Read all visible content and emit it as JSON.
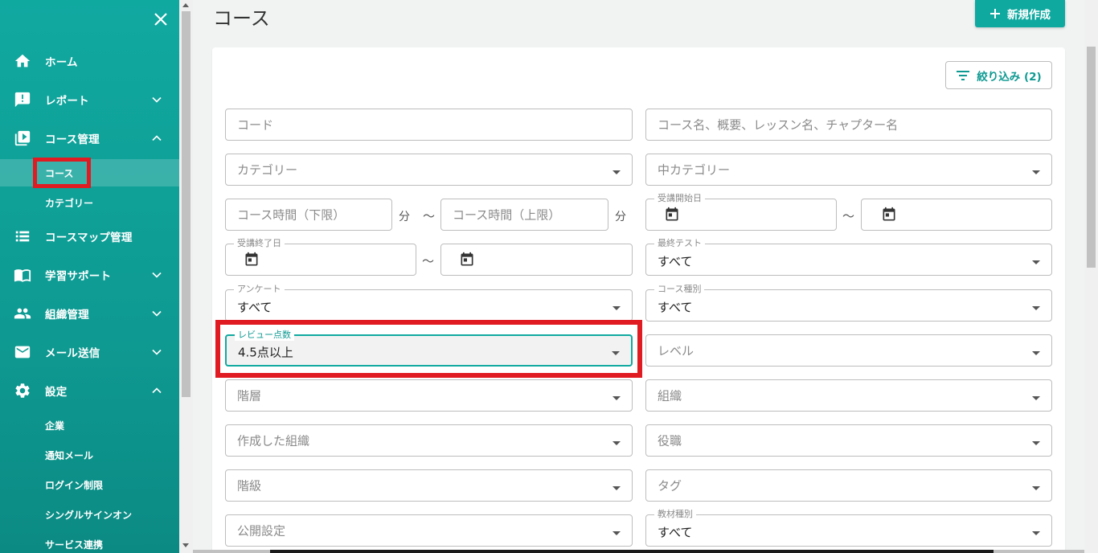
{
  "sidebar": {
    "items": [
      {
        "label": "ホーム",
        "icon": "home-icon"
      },
      {
        "label": "レポート",
        "icon": "report-icon"
      },
      {
        "label": "コース管理",
        "icon": "video-library-icon"
      },
      {
        "label": "コースマップ管理",
        "icon": "list-icon"
      },
      {
        "label": "学習サポート",
        "icon": "book-icon"
      },
      {
        "label": "組織管理",
        "icon": "people-icon"
      },
      {
        "label": "メール送信",
        "icon": "mail-icon"
      },
      {
        "label": "設定",
        "icon": "gear-icon"
      }
    ],
    "course_sub": [
      "コース",
      "カテゴリー"
    ],
    "settings_sub": [
      "企業",
      "通知メール",
      "ログイン制限",
      "シングルサインオン",
      "サービス連携"
    ]
  },
  "header": {
    "title": "コース",
    "new_button": "新規作成"
  },
  "filter_button": "絞り込み (2)",
  "fields": {
    "code": {
      "placeholder": "コード"
    },
    "keyword": {
      "placeholder": "コース名、概要、レッスン名、チャプター名"
    },
    "category": {
      "placeholder": "カテゴリー"
    },
    "mid_category": {
      "placeholder": "中カテゴリー"
    },
    "time_min": {
      "placeholder": "コース時間（下限）",
      "unit": "分"
    },
    "time_max": {
      "placeholder": "コース時間（上限）",
      "unit": "分"
    },
    "range_sep": "〜",
    "start_date": {
      "label": "受講開始日"
    },
    "end_date": {
      "label": "受講終了日"
    },
    "final_test": {
      "label": "最終テスト",
      "value": "すべて"
    },
    "survey": {
      "label": "アンケート",
      "value": "すべて"
    },
    "course_type": {
      "label": "コース種別",
      "value": "すべて"
    },
    "review_score": {
      "label": "レビュー点数",
      "value": "4.5点以上"
    },
    "level": {
      "placeholder": "レベル"
    },
    "tier": {
      "placeholder": "階層"
    },
    "organization": {
      "placeholder": "組織"
    },
    "created_org": {
      "placeholder": "作成した組織"
    },
    "position": {
      "placeholder": "役職"
    },
    "grade": {
      "placeholder": "階級"
    },
    "tag": {
      "placeholder": "タグ"
    },
    "publish": {
      "placeholder": "公開設定"
    },
    "material_type": {
      "label": "教材種別",
      "value": "すべて"
    }
  },
  "colors": {
    "primary": "#10a9a0",
    "highlight": "#e01b22"
  }
}
